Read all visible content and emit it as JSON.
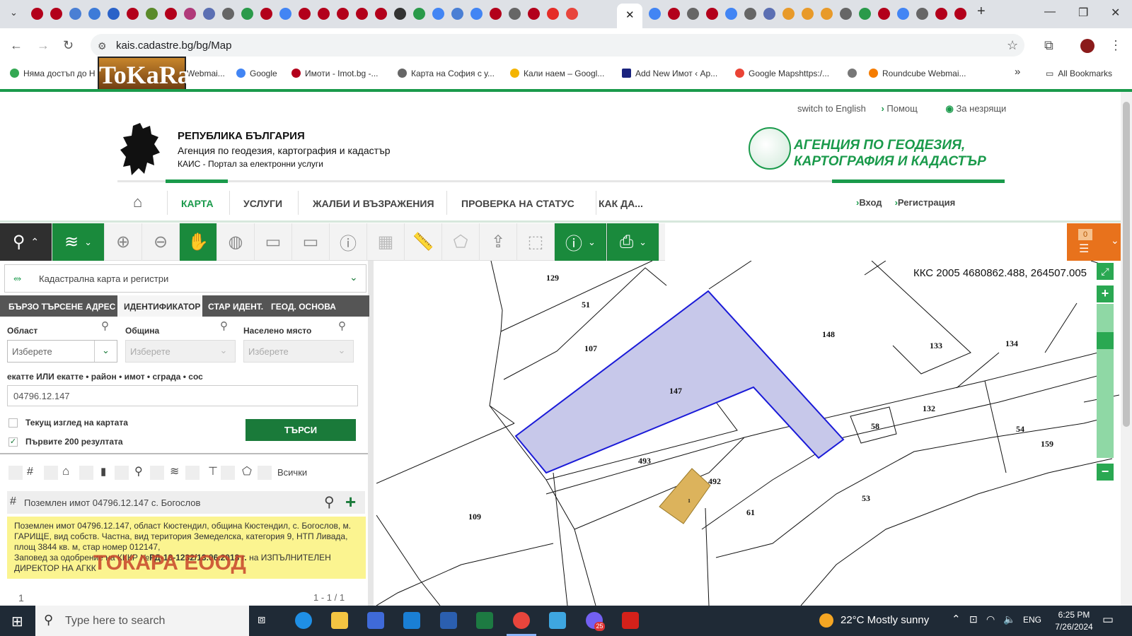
{
  "browser": {
    "url": "kais.cadastre.bg/bg/Map",
    "bookmarks": [
      {
        "label": "Няма достъп до Н"
      },
      {
        "label": "Webmai..."
      },
      {
        "label": "Google"
      },
      {
        "label": "Имоти - Imot.bg -..."
      },
      {
        "label": "Карта на София с у..."
      },
      {
        "label": "Кали наем – Googl..."
      },
      {
        "label": "Add New Имот ‹ Ар..."
      },
      {
        "label": "Google Mapshttps:/..."
      },
      {
        "label": "Roundcube Webmai..."
      },
      {
        "label": "All Bookmarks"
      }
    ],
    "overlay_logo": "ToKaRa"
  },
  "header": {
    "links": [
      "switch to English",
      "Помощ",
      "За незрящи"
    ],
    "republic": "РЕПУБЛИКА БЪЛГАРИЯ",
    "agency_line": "Агенция по геодезия, картография и кадастър",
    "portal_line": "КАИС - Портал за електронни услуги",
    "agency_logo_line1": "АГЕНЦИЯ ПО ГЕОДЕЗИЯ,",
    "agency_logo_line2": "КАРТОГРАФИЯ И КАДАСТЪР",
    "nav": [
      "КАРТА",
      "УСЛУГИ",
      "ЖАЛБИ И ВЪЗРАЖЕНИЯ",
      "ПРОВЕРКА НА СТАТУС",
      "КАК ДА..."
    ],
    "login": "Вход",
    "register": "Регистрация"
  },
  "toolbar": {
    "basket_count": "0"
  },
  "panel": {
    "layer": "Кадастрална карта и регистри",
    "tabs": [
      "БЪРЗО ТЪРСЕНЕ",
      "АДРЕС",
      "ИДЕНТИФИКАТОР",
      "СТАР ИДЕНТ.",
      "ГЕОД. ОСНОВА"
    ],
    "oblast_label": "Област",
    "obshtina_label": "Община",
    "naseleno_label": "Населено място",
    "select_placeholder": "Изберете",
    "id_label": "екатте ИЛИ екатте • район • имот • сграда • сос",
    "id_value": "04796.12.147",
    "chk_current_view": "Текущ изглед на картата",
    "chk_first_200": "Първите 200 резултата",
    "search_button": "ТЪРСИ",
    "filter_all": "Всички",
    "result_title": "Поземлен имот 04796.12.147 с. Богослов",
    "info_text": "Поземлен имот 04796.12.147, област Кюстендил, община Кюстендил, с. Богослов, м. ГАРИЩЕ, вид собств. Частна, вид територия Земеделска, категория 9, НТП Ливада, площ 3844 кв. м, стар номер 012147,",
    "info_order_prefix": "Заповед за одобрение на КККР №",
    "info_order_number": "РД-18-1232/13.06.2018 г.",
    "info_order_suffix": " на ИЗПЪЛНИТЕЛЕН ДИРЕКТОР НА АГКК",
    "watermark": "ТОКАРА ЕООД",
    "pager_page": "1",
    "pager_range": "1 - 1 / 1"
  },
  "map": {
    "coords": "ККС 2005 4680862.488, 264507.005",
    "parcel_labels": [
      "129",
      "51",
      "107",
      "147",
      "148",
      "133",
      "134",
      "132",
      "58",
      "54",
      "159",
      "493",
      "492",
      "1",
      "61",
      "53",
      "109"
    ],
    "selected_fill": "#c7c8ea",
    "selected_stroke": "#1a1ad8",
    "building_fill": "#dcb35c"
  },
  "taskbar": {
    "search_placeholder": "Type here to search",
    "weather": "22°C  Mostly sunny",
    "lang": "ENG",
    "time": "6:25 PM",
    "date": "7/26/2024",
    "badge": "25"
  }
}
